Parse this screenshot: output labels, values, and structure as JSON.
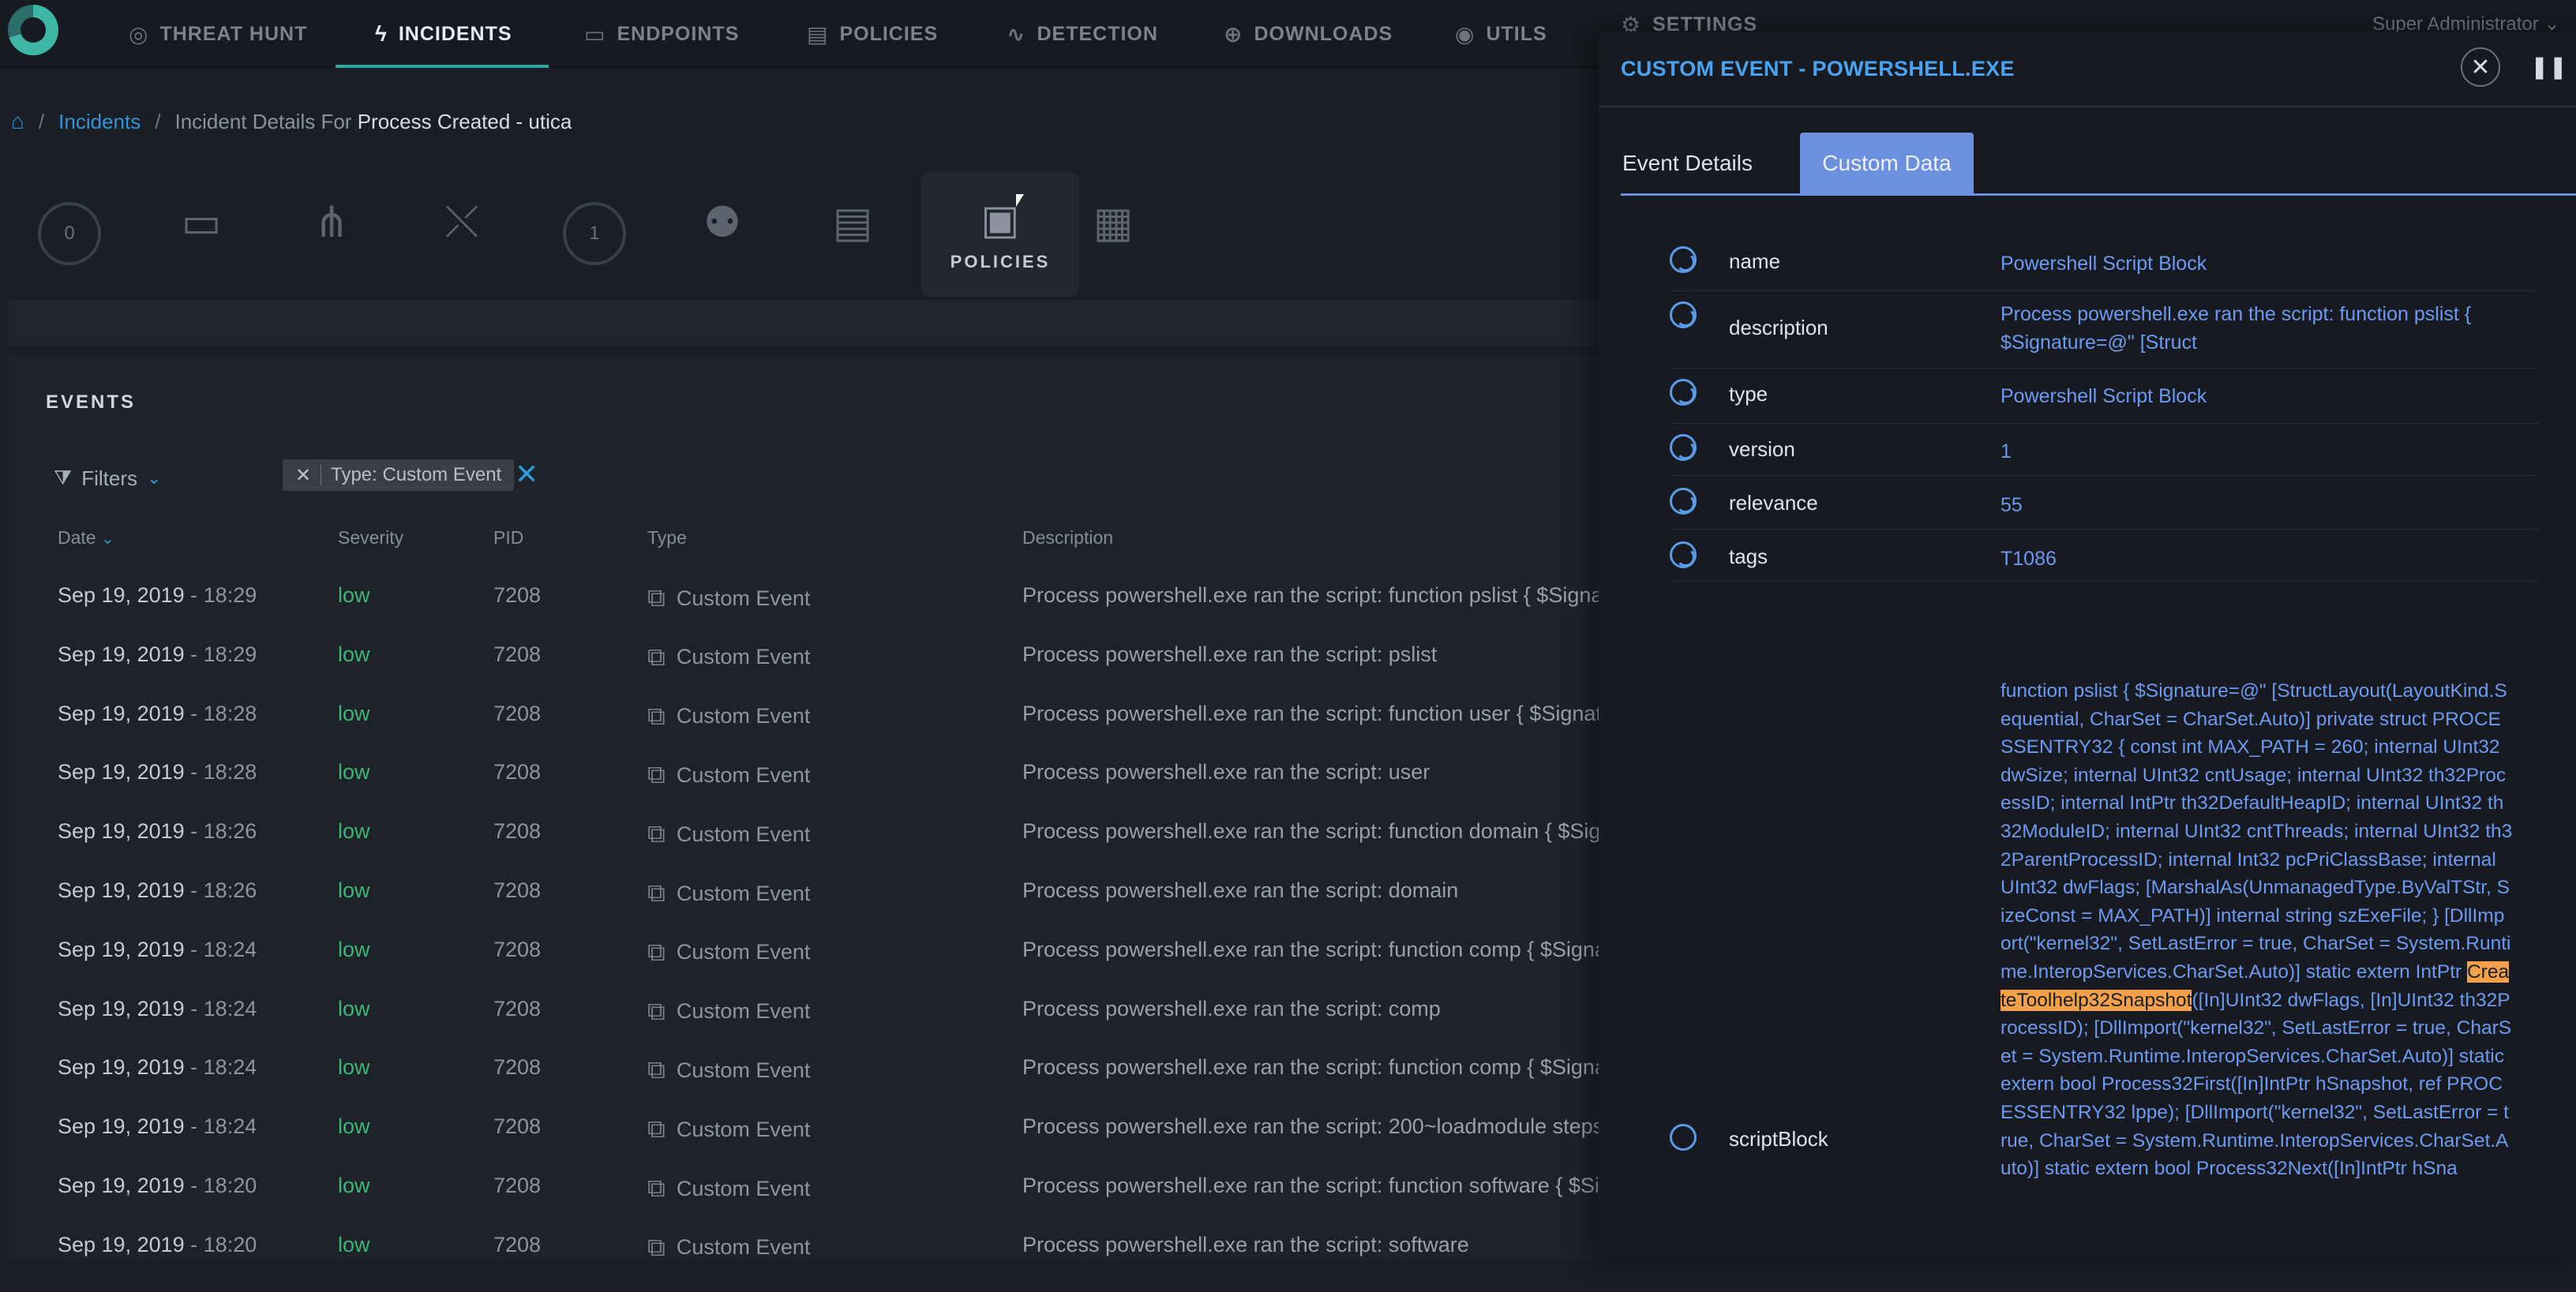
{
  "nav": {
    "items": [
      {
        "label": "THREAT HUNT",
        "icon": "target-icon",
        "glyph": "◎"
      },
      {
        "label": "INCIDENTS",
        "icon": "bolt-icon",
        "glyph": "ϟ"
      },
      {
        "label": "ENDPOINTS",
        "icon": "monitor-icon",
        "glyph": "▭"
      },
      {
        "label": "POLICIES",
        "icon": "policy-doc-icon",
        "glyph": "▤"
      },
      {
        "label": "DETECTION",
        "icon": "pulse-icon",
        "glyph": "∿"
      },
      {
        "label": "DOWNLOADS",
        "icon": "download-icon",
        "glyph": "⊕"
      },
      {
        "label": "UTILS",
        "icon": "utils-icon",
        "glyph": "◉"
      },
      {
        "label": "SETTINGS",
        "icon": "gear-icon",
        "glyph": "⚙"
      }
    ],
    "user": "Super Administrator"
  },
  "breadcrumb": {
    "home_glyph": "⌂",
    "incidents": "Incidents",
    "details_prefix": "Incident Details For",
    "details_name": "Process Created - utica"
  },
  "iconbar": {
    "count_zero": "0",
    "count_one": "1",
    "policies_label": "POLICIES"
  },
  "events": {
    "title": "EVENTS",
    "filters_label": "Filters",
    "chip_label": "Type: Custom Event",
    "columns": {
      "date": "Date",
      "severity": "Severity",
      "pid": "PID",
      "type": "Type",
      "description": "Description"
    },
    "rows": [
      {
        "date": "Sep 19, 2019",
        "time": "- 18:29",
        "severity": "low",
        "pid": "7208",
        "type": "Custom Event",
        "description": "Process powershell.exe ran the script: function pslist { $Signature=@\" [Struct"
      },
      {
        "date": "Sep 19, 2019",
        "time": "- 18:29",
        "severity": "low",
        "pid": "7208",
        "type": "Custom Event",
        "description": "Process powershell.exe ran the script: pslist"
      },
      {
        "date": "Sep 19, 2019",
        "time": "- 18:28",
        "severity": "low",
        "pid": "7208",
        "type": "Custom Event",
        "description": "Process powershell.exe ran the script: function user { $Signature"
      },
      {
        "date": "Sep 19, 2019",
        "time": "- 18:28",
        "severity": "low",
        "pid": "7208",
        "type": "Custom Event",
        "description": "Process powershell.exe ran the script: user"
      },
      {
        "date": "Sep 19, 2019",
        "time": "- 18:26",
        "severity": "low",
        "pid": "7208",
        "type": "Custom Event",
        "description": "Process powershell.exe ran the script: function domain { $Signature"
      },
      {
        "date": "Sep 19, 2019",
        "time": "- 18:26",
        "severity": "low",
        "pid": "7208",
        "type": "Custom Event",
        "description": "Process powershell.exe ran the script: domain"
      },
      {
        "date": "Sep 19, 2019",
        "time": "- 18:24",
        "severity": "low",
        "pid": "7208",
        "type": "Custom Event",
        "description": "Process powershell.exe ran the script: function comp { $Signature"
      },
      {
        "date": "Sep 19, 2019",
        "time": "- 18:24",
        "severity": "low",
        "pid": "7208",
        "type": "Custom Event",
        "description": "Process powershell.exe ran the script: comp"
      },
      {
        "date": "Sep 19, 2019",
        "time": "- 18:24",
        "severity": "low",
        "pid": "7208",
        "type": "Custom Event",
        "description": "Process powershell.exe ran the script: function comp { $Signature"
      },
      {
        "date": "Sep 19, 2019",
        "time": "- 18:24",
        "severity": "low",
        "pid": "7208",
        "type": "Custom Event",
        "description": "Process powershell.exe ran the script: 200~loadmodule steps"
      },
      {
        "date": "Sep 19, 2019",
        "time": "- 18:20",
        "severity": "low",
        "pid": "7208",
        "type": "Custom Event",
        "description": "Process powershell.exe ran the script: function software { $Signature"
      },
      {
        "date": "Sep 19, 2019",
        "time": "- 18:20",
        "severity": "low",
        "pid": "7208",
        "type": "Custom Event",
        "description": "Process powershell.exe ran the script: software"
      }
    ]
  },
  "drawer": {
    "title": "CUSTOM EVENT - POWERSHELL.EXE",
    "close_glyph": "✕",
    "pause_glyph": "❚❚",
    "tabs": [
      "Event Details",
      "Custom Data"
    ],
    "fields": [
      {
        "key": "name",
        "value": "Powershell Script Block"
      },
      {
        "key": "description",
        "value": "Process powershell.exe ran the script: function pslist { $Signature=@\" [Struct"
      },
      {
        "key": "type",
        "value": "Powershell Script Block"
      },
      {
        "key": "version",
        "value": "1"
      },
      {
        "key": "relevance",
        "value": "55"
      },
      {
        "key": "tags",
        "value": "T1086"
      }
    ],
    "script_key": "scriptBlock",
    "script_before": "function pslist { $Signature=@\" [StructLayout(LayoutKind.Sequential, CharSet = CharSet.Auto)] private struct PROCESSENTRY32 { const int MAX_PATH = 260; internal UInt32 dwSize; internal UInt32 cntUsage; internal UInt32 th32ProcessID; internal IntPtr th32DefaultHeapID; internal UInt32 th32ModuleID; internal UInt32 cntThreads; internal UInt32 th32ParentProcessID; internal Int32 pcPriClassBase; internal UInt32 dwFlags; [MarshalAs(UnmanagedType.ByValTStr, SizeConst = MAX_PATH)] internal string szExeFile; } [DllImport(\"kernel32\", SetLastError = true, CharSet = System.Runtime.InteropServices.CharSet.Auto)] static extern IntPtr ",
    "script_highlight": "CreateToolhelp32Snapshot",
    "script_after": "([In]UInt32 dwFlags, [In]UInt32 th32ProcessID); [DllImport(\"kernel32\", SetLastError = true, CharSet = System.Runtime.InteropServices.CharSet.Auto)] static extern bool Process32First([In]IntPtr hSnapshot, ref PROCESSENTRY32 lppe); [DllImport(\"kernel32\", SetLastError = true, CharSet = System.Runtime.InteropServices.CharSet.Auto)] static extern bool Process32Next([In]IntPtr hSna"
  }
}
